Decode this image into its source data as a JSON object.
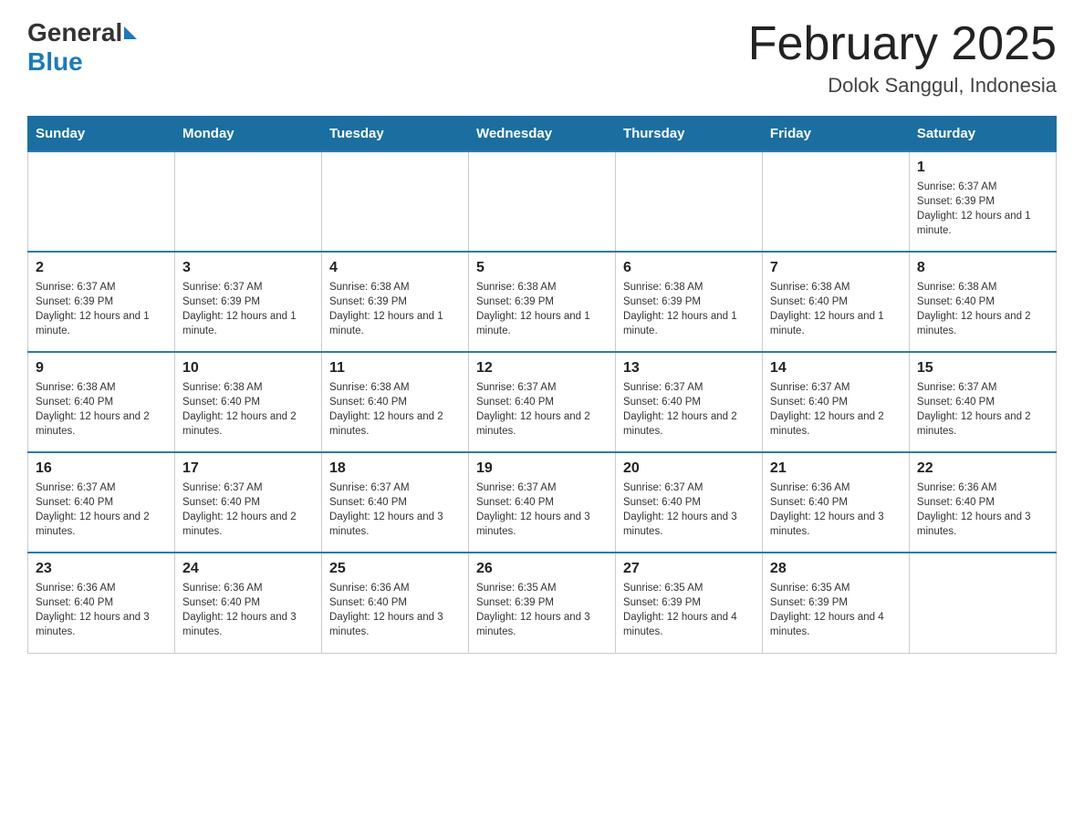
{
  "header": {
    "logo_general": "General",
    "logo_blue": "Blue",
    "month_title": "February 2025",
    "location": "Dolok Sanggul, Indonesia"
  },
  "days_of_week": [
    "Sunday",
    "Monday",
    "Tuesday",
    "Wednesday",
    "Thursday",
    "Friday",
    "Saturday"
  ],
  "weeks": [
    {
      "days": [
        {
          "number": "",
          "info": ""
        },
        {
          "number": "",
          "info": ""
        },
        {
          "number": "",
          "info": ""
        },
        {
          "number": "",
          "info": ""
        },
        {
          "number": "",
          "info": ""
        },
        {
          "number": "",
          "info": ""
        },
        {
          "number": "1",
          "info": "Sunrise: 6:37 AM\nSunset: 6:39 PM\nDaylight: 12 hours and 1 minute."
        }
      ]
    },
    {
      "days": [
        {
          "number": "2",
          "info": "Sunrise: 6:37 AM\nSunset: 6:39 PM\nDaylight: 12 hours and 1 minute."
        },
        {
          "number": "3",
          "info": "Sunrise: 6:37 AM\nSunset: 6:39 PM\nDaylight: 12 hours and 1 minute."
        },
        {
          "number": "4",
          "info": "Sunrise: 6:38 AM\nSunset: 6:39 PM\nDaylight: 12 hours and 1 minute."
        },
        {
          "number": "5",
          "info": "Sunrise: 6:38 AM\nSunset: 6:39 PM\nDaylight: 12 hours and 1 minute."
        },
        {
          "number": "6",
          "info": "Sunrise: 6:38 AM\nSunset: 6:39 PM\nDaylight: 12 hours and 1 minute."
        },
        {
          "number": "7",
          "info": "Sunrise: 6:38 AM\nSunset: 6:40 PM\nDaylight: 12 hours and 1 minute."
        },
        {
          "number": "8",
          "info": "Sunrise: 6:38 AM\nSunset: 6:40 PM\nDaylight: 12 hours and 2 minutes."
        }
      ]
    },
    {
      "days": [
        {
          "number": "9",
          "info": "Sunrise: 6:38 AM\nSunset: 6:40 PM\nDaylight: 12 hours and 2 minutes."
        },
        {
          "number": "10",
          "info": "Sunrise: 6:38 AM\nSunset: 6:40 PM\nDaylight: 12 hours and 2 minutes."
        },
        {
          "number": "11",
          "info": "Sunrise: 6:38 AM\nSunset: 6:40 PM\nDaylight: 12 hours and 2 minutes."
        },
        {
          "number": "12",
          "info": "Sunrise: 6:37 AM\nSunset: 6:40 PM\nDaylight: 12 hours and 2 minutes."
        },
        {
          "number": "13",
          "info": "Sunrise: 6:37 AM\nSunset: 6:40 PM\nDaylight: 12 hours and 2 minutes."
        },
        {
          "number": "14",
          "info": "Sunrise: 6:37 AM\nSunset: 6:40 PM\nDaylight: 12 hours and 2 minutes."
        },
        {
          "number": "15",
          "info": "Sunrise: 6:37 AM\nSunset: 6:40 PM\nDaylight: 12 hours and 2 minutes."
        }
      ]
    },
    {
      "days": [
        {
          "number": "16",
          "info": "Sunrise: 6:37 AM\nSunset: 6:40 PM\nDaylight: 12 hours and 2 minutes."
        },
        {
          "number": "17",
          "info": "Sunrise: 6:37 AM\nSunset: 6:40 PM\nDaylight: 12 hours and 2 minutes."
        },
        {
          "number": "18",
          "info": "Sunrise: 6:37 AM\nSunset: 6:40 PM\nDaylight: 12 hours and 3 minutes."
        },
        {
          "number": "19",
          "info": "Sunrise: 6:37 AM\nSunset: 6:40 PM\nDaylight: 12 hours and 3 minutes."
        },
        {
          "number": "20",
          "info": "Sunrise: 6:37 AM\nSunset: 6:40 PM\nDaylight: 12 hours and 3 minutes."
        },
        {
          "number": "21",
          "info": "Sunrise: 6:36 AM\nSunset: 6:40 PM\nDaylight: 12 hours and 3 minutes."
        },
        {
          "number": "22",
          "info": "Sunrise: 6:36 AM\nSunset: 6:40 PM\nDaylight: 12 hours and 3 minutes."
        }
      ]
    },
    {
      "days": [
        {
          "number": "23",
          "info": "Sunrise: 6:36 AM\nSunset: 6:40 PM\nDaylight: 12 hours and 3 minutes."
        },
        {
          "number": "24",
          "info": "Sunrise: 6:36 AM\nSunset: 6:40 PM\nDaylight: 12 hours and 3 minutes."
        },
        {
          "number": "25",
          "info": "Sunrise: 6:36 AM\nSunset: 6:40 PM\nDaylight: 12 hours and 3 minutes."
        },
        {
          "number": "26",
          "info": "Sunrise: 6:35 AM\nSunset: 6:39 PM\nDaylight: 12 hours and 3 minutes."
        },
        {
          "number": "27",
          "info": "Sunrise: 6:35 AM\nSunset: 6:39 PM\nDaylight: 12 hours and 4 minutes."
        },
        {
          "number": "28",
          "info": "Sunrise: 6:35 AM\nSunset: 6:39 PM\nDaylight: 12 hours and 4 minutes."
        },
        {
          "number": "",
          "info": ""
        }
      ]
    }
  ]
}
